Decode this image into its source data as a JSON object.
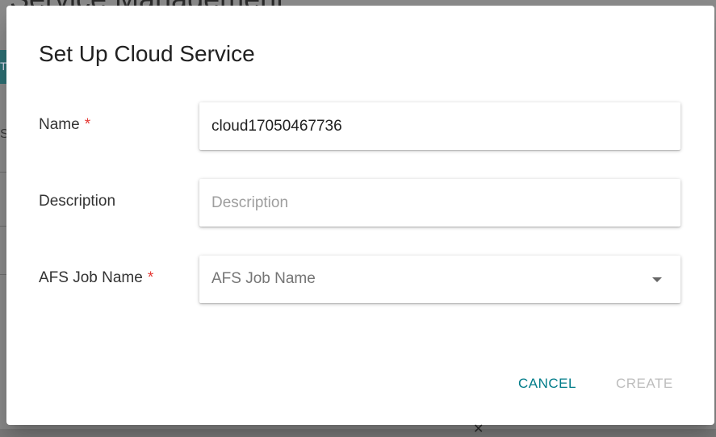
{
  "background": {
    "page_title": "Service Management",
    "side_tab_letter": "T",
    "side_text": "Se"
  },
  "dialog": {
    "title": "Set Up Cloud Service",
    "fields": {
      "name": {
        "label": "Name",
        "required_mark": "*",
        "value": "cloud17050467736"
      },
      "description": {
        "label": "Description",
        "placeholder": "Description",
        "value": ""
      },
      "afs_job": {
        "label": "AFS Job Name",
        "required_mark": "*",
        "selected": "AFS Job Name",
        "icon": "chevron-down-icon"
      }
    },
    "actions": {
      "cancel": "CANCEL",
      "create": "CREATE"
    }
  },
  "colors": {
    "accent": "#007c89",
    "required": "#e53935",
    "disabled": "#bdbdbd"
  }
}
